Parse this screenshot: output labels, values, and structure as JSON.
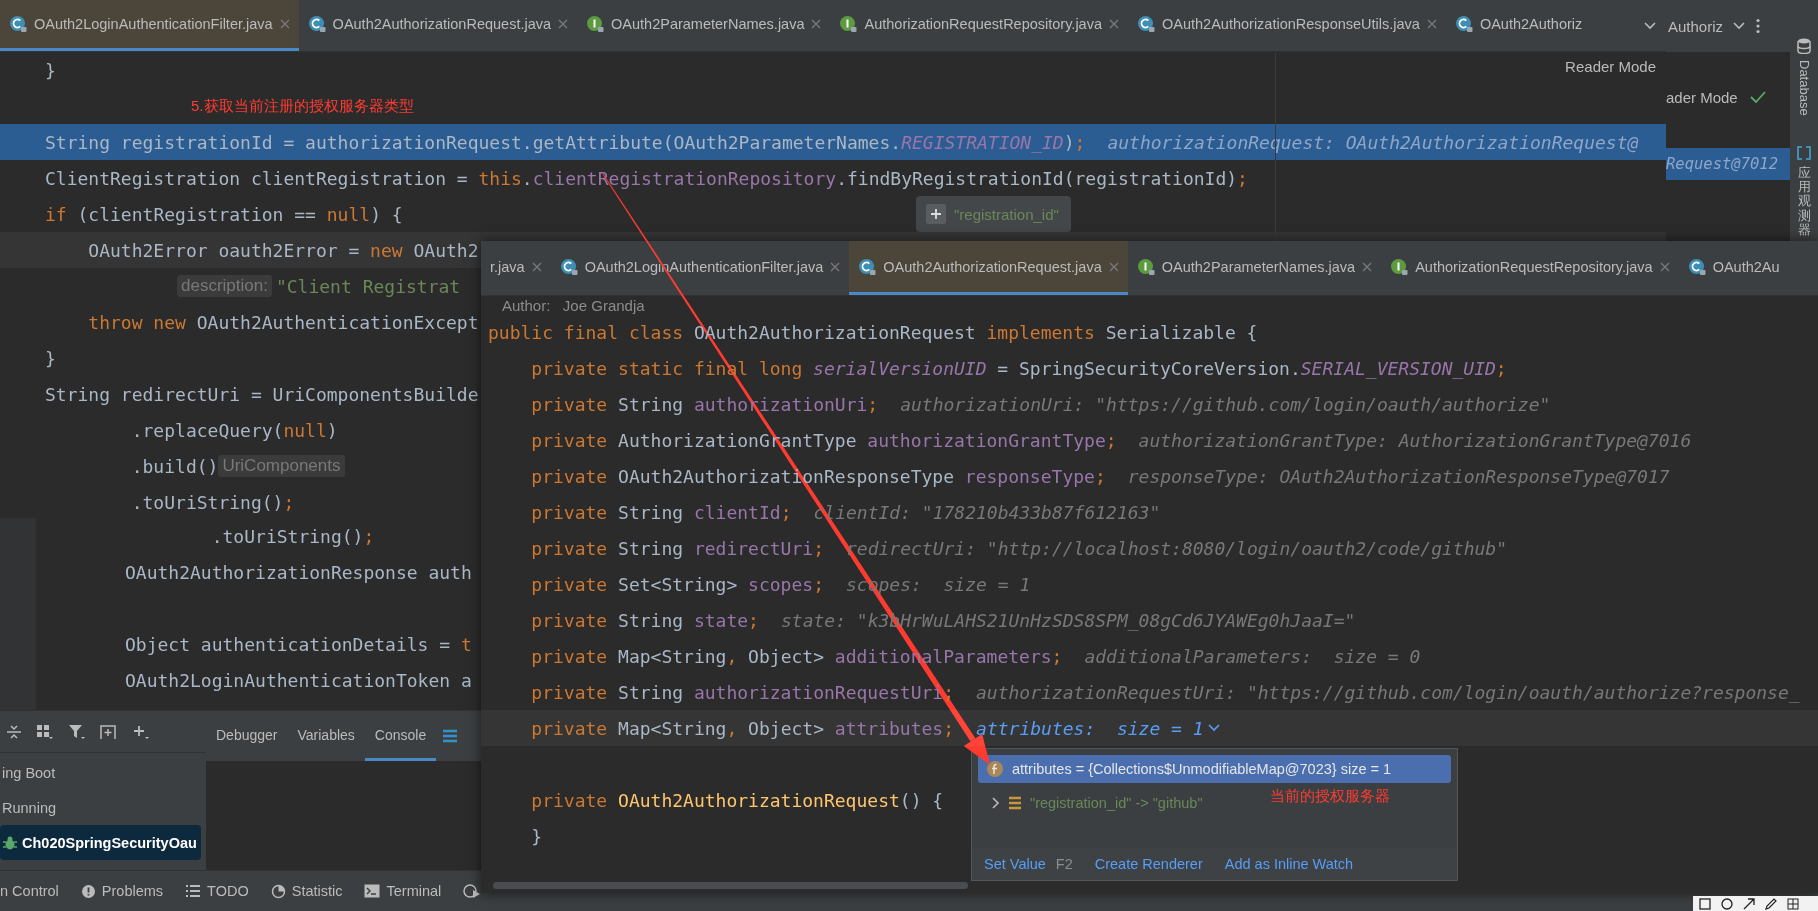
{
  "editor": {
    "tabs": [
      {
        "label": "OAuth2LoginAuthenticationFilter.java",
        "kind": "class",
        "close": true,
        "selected": true
      },
      {
        "label": "OAuth2AuthorizationRequest.java",
        "kind": "class",
        "close": true,
        "selected": false
      },
      {
        "label": "OAuth2ParameterNames.java",
        "kind": "interface",
        "close": true,
        "selected": false
      },
      {
        "label": "AuthorizationRequestRepository.java",
        "kind": "interface",
        "close": true,
        "selected": false
      },
      {
        "label": "OAuth2AuthorizationResponseUtils.java",
        "kind": "class",
        "close": true,
        "selected": false
      },
      {
        "label": "OAuth2Authoriz",
        "kind": "class",
        "close": false,
        "selected": false
      }
    ],
    "reader_mode": "Reader Mode",
    "tooltip": {
      "text": "\"registration_id\""
    },
    "lines": [
      {
        "kind": "code",
        "tokens": [
          {
            "kind": "plain",
            "text": "}"
          }
        ]
      },
      {
        "kind": "code",
        "tokens": [
          {
            "kind": "note",
            "text": "5.获取当前注册的授权服务器类型"
          }
        ]
      },
      {
        "kind": "execution",
        "tokens": [
          {
            "kind": "plain",
            "text": "String registrationId = authorizationRequest.getAttribute(OAuth2ParameterNames."
          },
          {
            "kind": "const",
            "text": "REGISTRATION_ID"
          },
          {
            "kind": "plain",
            "text": ")"
          },
          {
            "kind": "kw",
            "text": ";"
          },
          {
            "kind": "hint",
            "text": "authorizationRequest: OAuth2AuthorizationRequest@"
          }
        ]
      },
      {
        "kind": "code",
        "tokens": [
          {
            "kind": "plain",
            "text": "ClientRegistration clientRegistration = "
          },
          {
            "kind": "kw",
            "text": "this"
          },
          {
            "kind": "plain",
            "text": "."
          },
          {
            "kind": "field",
            "text": "clientRegistrationRepository"
          },
          {
            "kind": "plain",
            "text": ".findByRegistrationId(registrationId)"
          },
          {
            "kind": "kw",
            "text": ";"
          }
        ]
      },
      {
        "kind": "code",
        "tokens": [
          {
            "kind": "kw",
            "text": "if"
          },
          {
            "kind": "plain",
            "text": " (clientRegistration == "
          },
          {
            "kind": "kw",
            "text": "null"
          },
          {
            "kind": "plain",
            "text": ") {"
          }
        ]
      },
      {
        "kind": "caret",
        "tokens": [
          {
            "kind": "plain",
            "text": "    OAuth2Error oauth2Error = "
          },
          {
            "kind": "kw",
            "text": "new"
          },
          {
            "kind": "plain",
            "text": " OAuth2"
          }
        ]
      },
      {
        "kind": "code",
        "tokens": [
          {
            "kind": "inlay",
            "text": "description:"
          },
          {
            "kind": "str",
            "text": "\"Client Registrat"
          }
        ]
      },
      {
        "kind": "code",
        "tokens": [
          {
            "kind": "kw",
            "text": "    throw new"
          },
          {
            "kind": "plain",
            "text": " OAuth2AuthenticationExcept"
          }
        ]
      },
      {
        "kind": "code",
        "tokens": [
          {
            "kind": "plain",
            "text": "}"
          }
        ]
      },
      {
        "kind": "code",
        "tokens": [
          {
            "kind": "plain",
            "text": "String redirectUri = UriComponentsBuilde"
          }
        ]
      },
      {
        "kind": "code",
        "tokens": [
          {
            "kind": "plain",
            "text": "        .replaceQuery("
          },
          {
            "kind": "kw",
            "text": "null"
          },
          {
            "kind": "plain",
            "text": ")"
          }
        ]
      },
      {
        "kind": "code",
        "tokens": [
          {
            "kind": "plain",
            "text": "        .build()"
          },
          {
            "kind": "inlay",
            "text": "UriComponents"
          }
        ]
      },
      {
        "kind": "code",
        "tokens": [
          {
            "kind": "plain",
            "text": "        .toUriString()"
          },
          {
            "kind": "kw",
            "text": ";"
          }
        ]
      }
    ]
  },
  "side_panel": {
    "title": "Authoriz",
    "reader_mode": "ader Mode",
    "value": "Request@7012"
  },
  "tool_strip": [
    {
      "label": "Database",
      "kind": "rotated"
    },
    {
      "label": "应用观测器",
      "kind": "stacked"
    }
  ],
  "lower_editor": {
    "lines": [
      {
        "kind": "code",
        "tokens": [
          {
            "kind": "plain",
            "text": "        .toUriString()"
          },
          {
            "kind": "kw",
            "text": ";"
          }
        ]
      },
      {
        "kind": "code",
        "tokens": [
          {
            "kind": "plain",
            "text": "OAuth2AuthorizationResponse auth"
          }
        ]
      },
      {
        "kind": "code"
      },
      {
        "kind": "code",
        "tokens": [
          {
            "kind": "plain",
            "text": "Object authenticationDetails = "
          },
          {
            "kind": "kw",
            "text": "t"
          }
        ]
      },
      {
        "kind": "code",
        "tokens": [
          {
            "kind": "plain",
            "text": "OAuth2LoginAuthenticationToken a"
          }
        ]
      }
    ]
  },
  "debug_panel": {
    "tabs": [
      {
        "label": "Debugger",
        "selected": false
      },
      {
        "label": "Variables",
        "selected": false
      },
      {
        "label": "Console",
        "selected": true
      }
    ],
    "tree": [
      {
        "label": "ing Boot",
        "kind": "group",
        "selected": false
      },
      {
        "label": "Running",
        "kind": "group",
        "selected": false
      },
      {
        "label": "Ch020SpringSecurityOau",
        "kind": "session",
        "selected": true
      }
    ]
  },
  "status_bar": [
    {
      "label": "n Control",
      "kind": "plain"
    },
    {
      "label": "Problems",
      "kind": "problems"
    },
    {
      "label": "TODO",
      "kind": "todo"
    },
    {
      "label": "Statistic",
      "kind": "statistic"
    },
    {
      "label": "Terminal",
      "kind": "terminal"
    },
    {
      "kind": "services"
    }
  ],
  "overlay_editor": {
    "tabs": [
      {
        "label": "r.java",
        "kind": "partial",
        "close": true,
        "selected": false
      },
      {
        "label": "OAuth2LoginAuthenticationFilter.java",
        "kind": "class",
        "close": true,
        "selected": false
      },
      {
        "label": "OAuth2AuthorizationRequest.java",
        "kind": "class",
        "close": true,
        "selected": true
      },
      {
        "label": "OAuth2ParameterNames.java",
        "kind": "interface",
        "close": true,
        "selected": false
      },
      {
        "label": "AuthorizationRequestRepository.java",
        "kind": "interface",
        "close": true,
        "selected": false
      },
      {
        "label": "OAuth2Au",
        "kind": "class",
        "close": false,
        "selected": false
      }
    ],
    "lines": [
      {
        "kind": "code",
        "tokens": [
          {
            "kind": "doc",
            "text": "Author:   Joe Grandja"
          }
        ]
      },
      {
        "kind": "code",
        "tokens": [
          {
            "kind": "kw",
            "text": "public final class"
          },
          {
            "kind": "plain",
            "text": " OAuth2AuthorizationRequest "
          },
          {
            "kind": "kw",
            "text": "implements"
          },
          {
            "kind": "plain",
            "text": " Serializable {"
          }
        ]
      },
      {
        "kind": "code",
        "tokens": [
          {
            "kind": "kw",
            "text": "    private static final long "
          },
          {
            "kind": "const",
            "text": "serialVersionUID"
          },
          {
            "kind": "plain",
            "text": " = SpringSecurityCoreVersion."
          },
          {
            "kind": "const",
            "text": "SERIAL_VERSION_UID"
          },
          {
            "kind": "kw",
            "text": ";"
          }
        ]
      },
      {
        "kind": "code",
        "tokens": [
          {
            "kind": "kw",
            "text": "    private"
          },
          {
            "kind": "plain",
            "text": " String "
          },
          {
            "kind": "field",
            "text": "authorizationUri"
          },
          {
            "kind": "kw",
            "text": ";"
          },
          {
            "kind": "hint",
            "text": "authorizationUri: \"https://github.com/login/oauth/authorize\""
          }
        ]
      },
      {
        "kind": "code",
        "tokens": [
          {
            "kind": "kw",
            "text": "    private"
          },
          {
            "kind": "plain",
            "text": " AuthorizationGrantType "
          },
          {
            "kind": "field",
            "text": "authorizationGrantType"
          },
          {
            "kind": "kw",
            "text": ";"
          },
          {
            "kind": "hint",
            "text": "authorizationGrantType: AuthorizationGrantType@7016"
          }
        ]
      },
      {
        "kind": "code",
        "tokens": [
          {
            "kind": "kw",
            "text": "    private"
          },
          {
            "kind": "plain",
            "text": " OAuth2AuthorizationResponseType "
          },
          {
            "kind": "field",
            "text": "responseType"
          },
          {
            "kind": "kw",
            "text": ";"
          },
          {
            "kind": "hint",
            "text": "responseType: OAuth2AuthorizationResponseType@7017"
          }
        ]
      },
      {
        "kind": "code",
        "tokens": [
          {
            "kind": "kw",
            "text": "    private"
          },
          {
            "kind": "plain",
            "text": " String "
          },
          {
            "kind": "field",
            "text": "clientId"
          },
          {
            "kind": "kw",
            "text": ";"
          },
          {
            "kind": "hint",
            "text": "clientId: \"178210b433b87f612163\""
          }
        ]
      },
      {
        "kind": "code",
        "tokens": [
          {
            "kind": "kw",
            "text": "    private"
          },
          {
            "kind": "plain",
            "text": " String "
          },
          {
            "kind": "field",
            "text": "redirectUri"
          },
          {
            "kind": "kw",
            "text": ";"
          },
          {
            "kind": "hint",
            "text": "redirectUri: \"http://localhost:8080/login/oauth2/code/github\""
          }
        ]
      },
      {
        "kind": "code",
        "tokens": [
          {
            "kind": "kw",
            "text": "    private"
          },
          {
            "kind": "plain",
            "text": " Set<String> "
          },
          {
            "kind": "field",
            "text": "scopes"
          },
          {
            "kind": "kw",
            "text": ";"
          },
          {
            "kind": "hint",
            "text": "scopes:  size = 1"
          }
        ]
      },
      {
        "kind": "code",
        "tokens": [
          {
            "kind": "kw",
            "text": "    private"
          },
          {
            "kind": "plain",
            "text": " String "
          },
          {
            "kind": "field",
            "text": "state"
          },
          {
            "kind": "kw",
            "text": ";"
          },
          {
            "kind": "hint",
            "text": "state: \"k3bHrWuLAHS21UnHzSDS8SPM_08gCd6JYAWEg0hJaaI=\""
          }
        ]
      },
      {
        "kind": "code",
        "tokens": [
          {
            "kind": "kw",
            "text": "    private"
          },
          {
            "kind": "plain",
            "text": " Map<String"
          },
          {
            "kind": "kw",
            "text": ","
          },
          {
            "kind": "plain",
            "text": " Object> "
          },
          {
            "kind": "field",
            "text": "additionalParameters"
          },
          {
            "kind": "kw",
            "text": ";"
          },
          {
            "kind": "hint",
            "text": "additionalParameters:  size = 0"
          }
        ]
      },
      {
        "kind": "code",
        "tokens": [
          {
            "kind": "kw",
            "text": "    private"
          },
          {
            "kind": "plain",
            "text": " String "
          },
          {
            "kind": "field",
            "text": "authorizationRequestUri"
          },
          {
            "kind": "kw",
            "text": ";"
          },
          {
            "kind": "hint",
            "text": "authorizationRequestUri: \"https://github.com/login/oauth/authorize?response_"
          }
        ]
      },
      {
        "kind": "caret",
        "tokens": [
          {
            "kind": "kw",
            "text": "    private"
          },
          {
            "kind": "plain",
            "text": " Map<String"
          },
          {
            "kind": "kw",
            "text": ","
          },
          {
            "kind": "plain",
            "text": " Object> "
          },
          {
            "kind": "field",
            "text": "attributes"
          },
          {
            "kind": "kw",
            "text": ";"
          },
          {
            "kind": "hint-active",
            "text": "attributes:  size = 1"
          },
          {
            "kind": "expand"
          }
        ]
      },
      {
        "kind": "code"
      },
      {
        "kind": "code",
        "tokens": [
          {
            "kind": "kw",
            "text": "    private "
          },
          {
            "kind": "method",
            "text": "OAuth2AuthorizationRequest"
          },
          {
            "kind": "plain",
            "text": "() {"
          }
        ]
      },
      {
        "kind": "code",
        "tokens": [
          {
            "kind": "plain",
            "text": "    }"
          }
        ]
      }
    ],
    "popup": {
      "rows": [
        {
          "kind": "field",
          "text": "attributes = {Collections$UnmodifiableMap@7023}  size = 1",
          "selected": true
        },
        {
          "kind": "entry",
          "text": "\"registration_id\" -> \"github\"",
          "selected": false
        }
      ],
      "note": "当前的授权服务器",
      "actions": [
        {
          "label": "Set Value",
          "shortcut": "F2"
        },
        {
          "label": "Create Renderer"
        },
        {
          "label": "Add as Inline Watch"
        }
      ]
    }
  }
}
